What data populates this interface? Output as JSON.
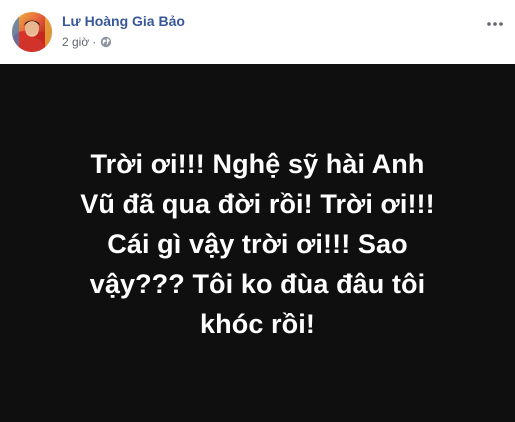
{
  "post": {
    "author_name": "Lư Hoàng Gia Bảo",
    "timestamp": "2 giờ",
    "separator": "·",
    "privacy_icon": "globe-icon",
    "more_icon": "more-options-icon",
    "status_text": "Trời ơi!!! Nghệ sỹ hài Anh Vũ đã qua đời rồi! Trời ơi!!! Cái gì vậy trời ơi!!! Sao vậy??? Tôi ko đùa đâu tôi khóc rồi!",
    "status_background_color": "#0f0f0f",
    "status_text_color": "#ffffff",
    "author_name_color": "#385898"
  }
}
